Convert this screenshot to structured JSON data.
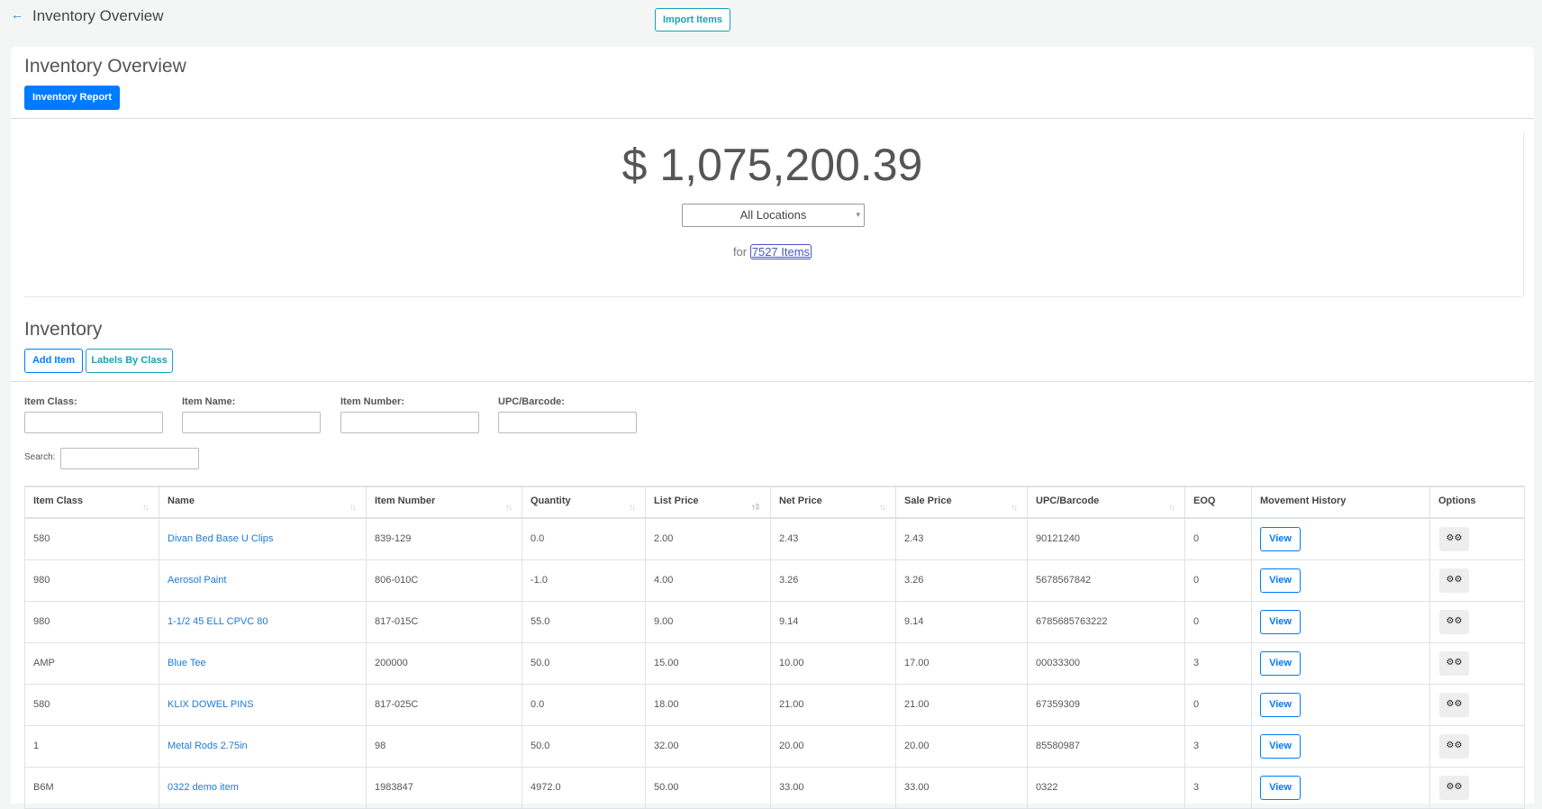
{
  "topbar": {
    "back_icon": "arrow-left-icon",
    "title": "Inventory Overview",
    "import_label": "Import Items"
  },
  "overview": {
    "title": "Inventory Overview",
    "report_label": "Inventory Report",
    "total_value": "$ 1,075,200.39",
    "location_selected": "All Locations",
    "for_text": "for",
    "items_link": "7527 Items"
  },
  "inventory": {
    "title": "Inventory",
    "add_label": "Add Item",
    "labels_label": "Labels By Class",
    "filters": {
      "item_class_label": "Item Class:",
      "item_name_label": "Item Name:",
      "item_number_label": "Item Number:",
      "upc_label": "UPC/Barcode:",
      "item_class_value": "",
      "item_name_value": "",
      "item_number_value": "",
      "upc_value": ""
    },
    "search_label": "Search:",
    "search_value": "",
    "columns": [
      "Item Class",
      "Name",
      "Item Number",
      "Quantity",
      "List Price",
      "Net Price",
      "Sale Price",
      "UPC/Barcode",
      "EOQ",
      "Movement History",
      "Options"
    ],
    "sorted_column": "List Price",
    "sort_direction": "ascending",
    "view_label": "View",
    "options_icon": "gears-icon",
    "rows": [
      {
        "item_class": "580",
        "name": "Divan Bed Base U Clips",
        "item_number": "839-129",
        "quantity": "0.0",
        "list_price": "2.00",
        "net_price": "2.43",
        "sale_price": "2.43",
        "upc": "90121240",
        "eoq": "0"
      },
      {
        "item_class": "980",
        "name": "Aerosol Paint",
        "item_number": "806-010C",
        "quantity": "-1.0",
        "list_price": "4.00",
        "net_price": "3.26",
        "sale_price": "3.26",
        "upc": "5678567842",
        "eoq": "0"
      },
      {
        "item_class": "980",
        "name": "1-1/2 45 ELL CPVC 80",
        "item_number": "817-015C",
        "quantity": "55.0",
        "list_price": "9.00",
        "net_price": "9.14",
        "sale_price": "9.14",
        "upc": "6785685763222",
        "eoq": "0"
      },
      {
        "item_class": "AMP",
        "name": "Blue Tee",
        "item_number": "200000",
        "quantity": "50.0",
        "list_price": "15.00",
        "net_price": "10.00",
        "sale_price": "17.00",
        "upc": "00033300",
        "eoq": "3"
      },
      {
        "item_class": "580",
        "name": "KLIX DOWEL PINS",
        "item_number": "817-025C",
        "quantity": "0.0",
        "list_price": "18.00",
        "net_price": "21.00",
        "sale_price": "21.00",
        "upc": "67359309",
        "eoq": "0"
      },
      {
        "item_class": "1",
        "name": "Metal Rods 2.75in",
        "item_number": "98",
        "quantity": "50.0",
        "list_price": "32.00",
        "net_price": "20.00",
        "sale_price": "20.00",
        "upc": "85580987",
        "eoq": "3"
      },
      {
        "item_class": "B6M",
        "name": "0322 demo item",
        "item_number": "1983847",
        "quantity": "4972.0",
        "list_price": "50.00",
        "net_price": "33.00",
        "sale_price": "33.00",
        "upc": "0322",
        "eoq": "3"
      }
    ]
  }
}
